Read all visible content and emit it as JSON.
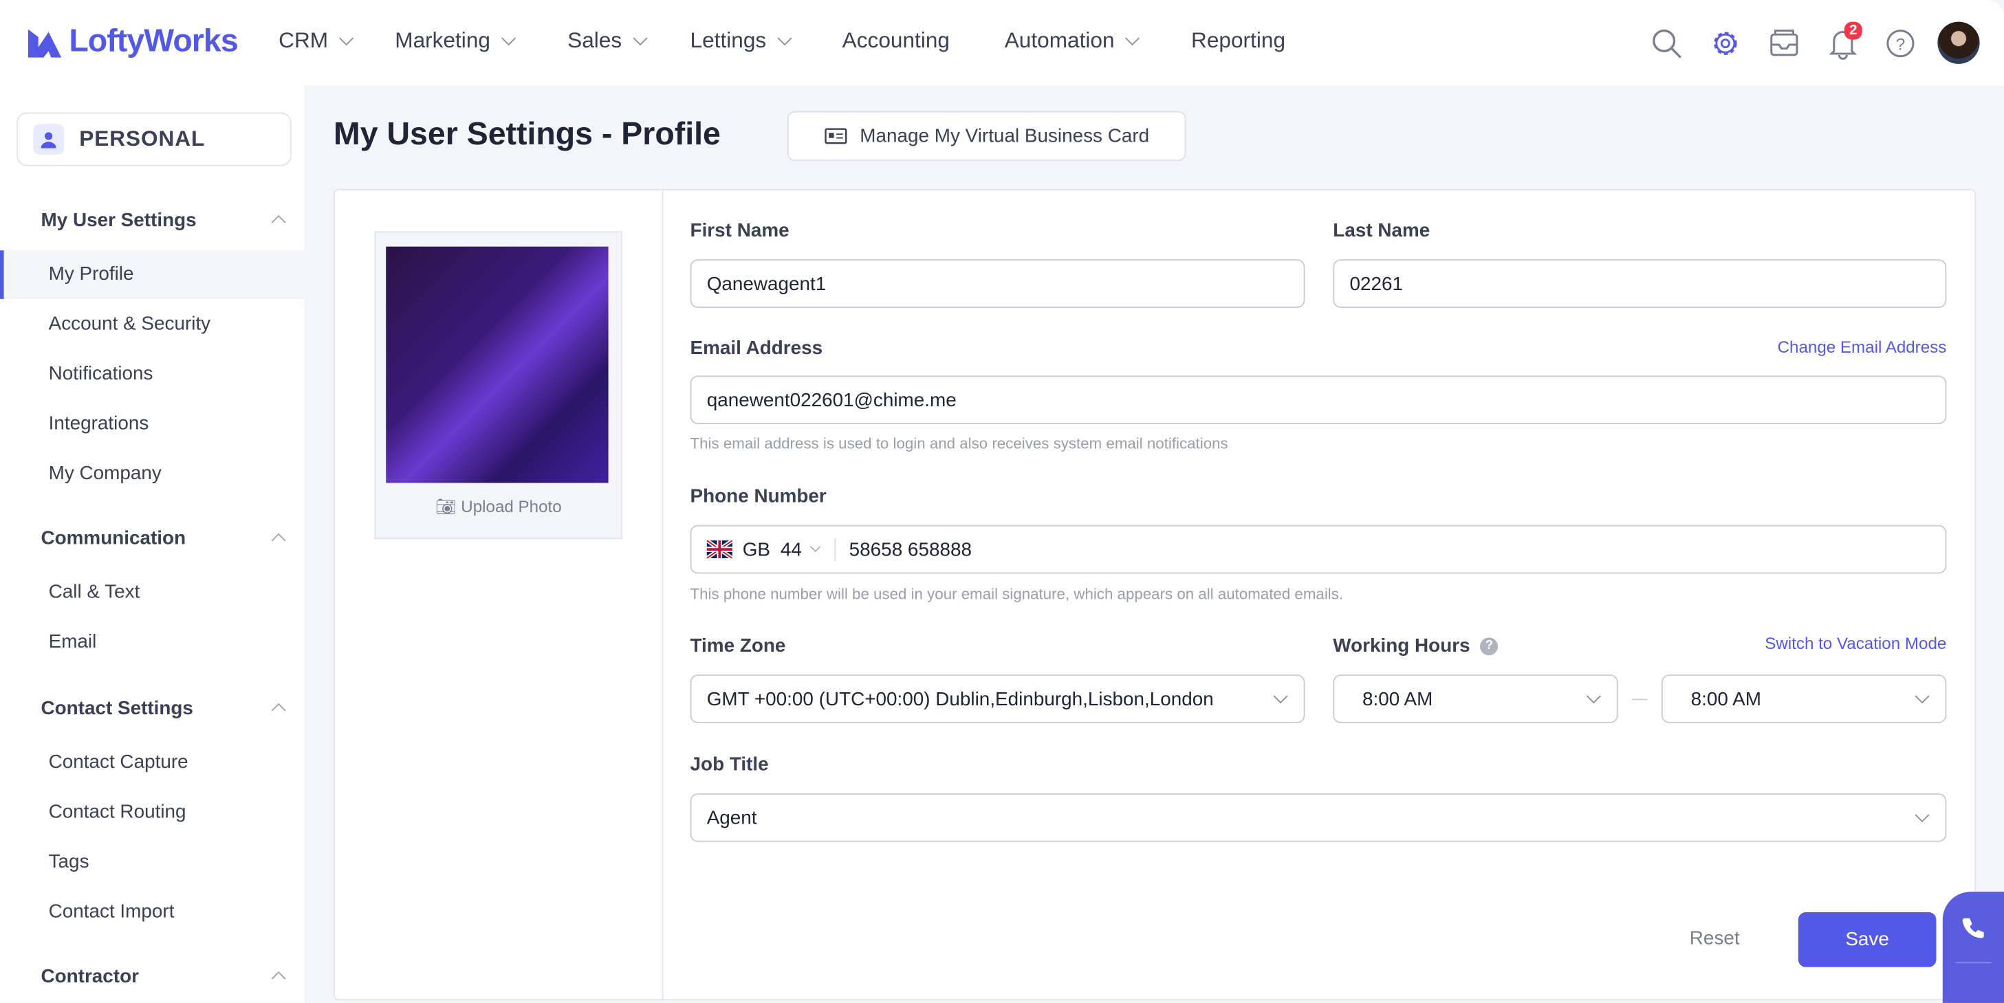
{
  "app": {
    "logo": "LoftyWorks"
  },
  "nav": [
    {
      "label": "CRM",
      "dropdown": true
    },
    {
      "label": "Marketing",
      "dropdown": true
    },
    {
      "label": "Sales",
      "dropdown": true
    },
    {
      "label": "Lettings",
      "dropdown": true
    },
    {
      "label": "Accounting",
      "dropdown": false
    },
    {
      "label": "Automation",
      "dropdown": true
    },
    {
      "label": "Reporting",
      "dropdown": false
    }
  ],
  "header_icons": {
    "notifications_count": "2",
    "accent": "#5458e6"
  },
  "sidebar": {
    "personal": "PERSONAL",
    "groups": [
      {
        "title": "My User Settings",
        "items": [
          "My Profile",
          "Account & Security",
          "Notifications",
          "Integrations",
          "My Company"
        ]
      },
      {
        "title": "Communication",
        "items": [
          "Call & Text",
          "Email"
        ]
      },
      {
        "title": "Contact Settings",
        "items": [
          "Contact Capture",
          "Contact Routing",
          "Tags",
          "Contact Import"
        ]
      },
      {
        "title": "Contractor",
        "items": []
      }
    ],
    "active": "My Profile"
  },
  "page": {
    "title": "My User Settings - Profile",
    "vcard_button": "Manage My Virtual Business Card"
  },
  "profile": {
    "upload_photo": "Upload Photo"
  },
  "form": {
    "first_name_label": "First Name",
    "first_name": "Qanewagent1",
    "last_name_label": "Last Name",
    "last_name": "02261",
    "email_label": "Email Address",
    "change_email": "Change Email Address",
    "email": "qanewent022601@chime.me",
    "email_hint": "This email address is used to login and also receives system email notifications",
    "phone_label": "Phone Number",
    "country": "GB",
    "country_code": "44",
    "phone": "58658 658888",
    "phone_hint": "This phone number will be used in your email signature, which appears on all automated emails.",
    "timezone_label": "Time Zone",
    "timezone": "GMT +00:00 (UTC+00:00) Dublin,Edinburgh,Lisbon,London",
    "hours_label": "Working Hours",
    "vacation": "Switch to Vacation Mode",
    "hours_from": "8:00 AM",
    "hours_to": "8:00 AM",
    "job_label": "Job Title",
    "job": "Agent",
    "reset": "Reset",
    "save": "Save"
  }
}
